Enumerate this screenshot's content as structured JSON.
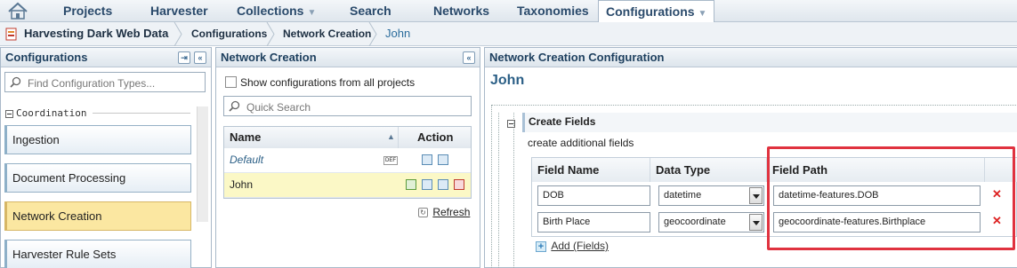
{
  "nav": {
    "tabs": [
      {
        "label": "Projects"
      },
      {
        "label": "Harvester"
      },
      {
        "label": "Collections"
      },
      {
        "label": "Search"
      },
      {
        "label": "Networks"
      },
      {
        "label": "Taxonomies"
      },
      {
        "label": "Configurations",
        "active": true
      }
    ]
  },
  "breadcrumb": {
    "project": "Harvesting Dark Web Data",
    "items": [
      "Configurations",
      "Network Creation",
      "John"
    ]
  },
  "left_panel": {
    "title": "Configurations",
    "search_placeholder": "Find Configuration Types...",
    "section": "Coordination",
    "items": [
      {
        "label": "Ingestion"
      },
      {
        "label": "Document Processing"
      },
      {
        "label": "Network Creation",
        "active": true
      },
      {
        "label": "Harvester Rule Sets"
      }
    ]
  },
  "middle_panel": {
    "title": "Network Creation",
    "show_all_label": "Show configurations from all projects",
    "search_placeholder": "Quick Search",
    "columns": {
      "name": "Name",
      "action": "Action"
    },
    "rows": [
      {
        "name": "Default",
        "badge": "DEF"
      },
      {
        "name": "John",
        "selected": true
      }
    ],
    "refresh_label": "Refresh"
  },
  "right_panel": {
    "title": "Network Creation Configuration",
    "config_name": "John",
    "section_title": "Create Fields",
    "section_desc": "create additional fields",
    "columns": {
      "field_name": "Field Name",
      "data_type": "Data Type",
      "field_path": "Field Path"
    },
    "fields": [
      {
        "name": "DOB",
        "type": "datetime",
        "path": "datetime-features.DOB"
      },
      {
        "name": "Birth Place",
        "type": "geocoordinate",
        "path": "geocoordinate-features.Birthplace"
      }
    ],
    "add_label": "Add (Fields)"
  },
  "colors": {
    "highlight": "#e0323f",
    "active_item": "#fbe7a1",
    "selected_row": "#fbf8c6",
    "accent": "#2b5f86"
  }
}
